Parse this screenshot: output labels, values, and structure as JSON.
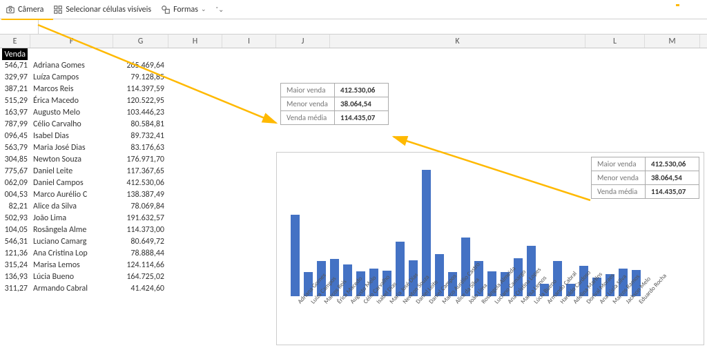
{
  "toolbar": {
    "camera": "Câmera",
    "select_visible": "Selecionar células visíveis",
    "shapes": "Formas"
  },
  "columns": [
    "E",
    "F",
    "G",
    "H",
    "I",
    "J",
    "K",
    "L",
    "M"
  ],
  "venda_header": "Venda",
  "colE_values": [
    "546,71",
    "329,97",
    "387,21",
    "515,29",
    "163,97",
    "787,99",
    "096,45",
    "563,79",
    "304,85",
    "775,67",
    "062,09",
    "004,53",
    "82,21",
    "502,93",
    "104,05",
    "546,31",
    "121,36",
    "315,24",
    "136,93",
    "311,27"
  ],
  "colF_names": [
    "Adriana Gomes",
    "Luíza Campos",
    "Marcos Reis",
    "Érica Macedo",
    "Augusto Melo",
    "Célio Carvalho",
    "Isabel Dias",
    "Maria José Dias",
    "Newton Souza",
    "Daniel Leite",
    "Daniel Campos",
    "Marco Aurélio C",
    "Alice da Silva",
    "João Lima",
    "Rosângela Alme",
    "Luciano Camarg",
    "Ana Cristina Lop",
    "Marisa Lemos",
    "Lúcia Bueno",
    "Armando Cabral"
  ],
  "colG_values": [
    "265.469,64",
    "79.128,85",
    "114.397,59",
    "120.522,95",
    "103.446,23",
    "80.584,81",
    "89.732,41",
    "83.176,63",
    "176.971,70",
    "117.367,65",
    "412.530,06",
    "138.387,49",
    "78.069,84",
    "191.632,57",
    "114.373,00",
    "80.649,72",
    "78.888,44",
    "124.114,66",
    "164.725,02",
    "41.424,60"
  ],
  "stats": {
    "maior_label": "Maior venda",
    "maior_value": "412.530,06",
    "menor_label": "Menor venda",
    "menor_value": "38.064,54",
    "media_label": "Venda média",
    "media_value": "114.435,07"
  },
  "chart_data": {
    "type": "bar",
    "categories": [
      "Adriana Gomes",
      "Luíza Campos",
      "Marcos Reis",
      "Érica Macedo",
      "Augusto Melo",
      "Célio Carvalho",
      "Isabel Dias",
      "Maria José Dias",
      "Newton Souza",
      "Daniel Leite",
      "Daniel Campos",
      "Marco Aurélio Castro",
      "Alice da Silva",
      "João Lima",
      "Rosângela Almeida",
      "Luciano Camargo",
      "Ana Cristina Lopes",
      "Marisa Lemos",
      "Lúcia Bueno",
      "Armando Cabral",
      "Haroldo Cardoso",
      "Adelina Martins",
      "Dorival Moraes",
      "Ana Lúcia Silva",
      "Marcos Ramos",
      "Jackson Melo",
      "Eduardo Rocha"
    ],
    "values": [
      265469,
      79129,
      114398,
      120523,
      103446,
      80585,
      89732,
      83177,
      176972,
      117368,
      412530,
      138387,
      78070,
      191633,
      114373,
      80650,
      78888,
      124115,
      164725,
      41425,
      115000,
      40000,
      100000,
      60000,
      72000,
      90000,
      85000
    ],
    "title": "",
    "xlabel": "",
    "ylabel": "",
    "ylim": [
      0,
      450000
    ]
  }
}
